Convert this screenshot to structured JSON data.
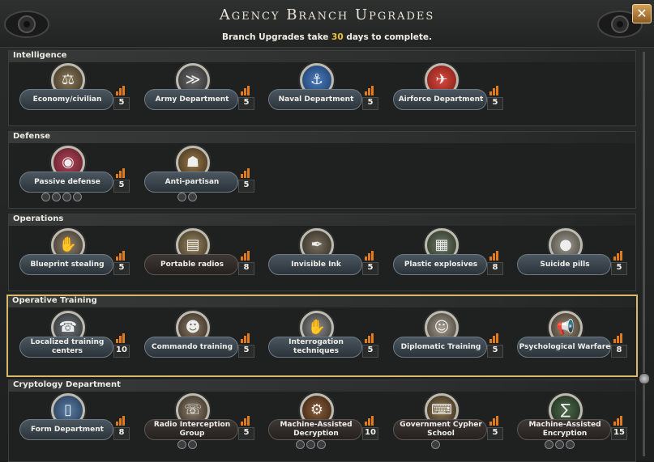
{
  "header": {
    "title": "Agency Branch Upgrades",
    "subtitle_prefix": "Branch Upgrades take ",
    "subtitle_days": "30",
    "subtitle_suffix": " days to complete.",
    "close_label": "✕"
  },
  "sections": [
    {
      "label": "Intelligence",
      "cards": [
        {
          "label": "Economy/civilian",
          "level": "5",
          "icon": "economy-emblem-icon"
        },
        {
          "label": "Army Department",
          "level": "5",
          "icon": "army-emblem-icon"
        },
        {
          "label": "Naval Department",
          "level": "5",
          "icon": "anchor-emblem-icon"
        },
        {
          "label": "Airforce Department",
          "level": "5",
          "icon": "airplane-emblem-icon"
        }
      ]
    },
    {
      "label": "Defense",
      "cards": [
        {
          "label": "Passive defense",
          "level": "5",
          "icon": "eye-emblem-icon"
        },
        {
          "label": "Anti-partisan",
          "level": "5",
          "icon": "partisan-icon"
        }
      ]
    },
    {
      "label": "Operations",
      "cards": [
        {
          "label": "Blueprint stealing",
          "level": "5",
          "icon": "blueprint-icon"
        },
        {
          "label": "Portable radios",
          "level": "8",
          "icon": "radio-icon"
        },
        {
          "label": "Invisible Ink",
          "level": "5",
          "icon": "ink-pen-icon"
        },
        {
          "label": "Plastic explosives",
          "level": "8",
          "icon": "explosives-icon"
        },
        {
          "label": "Suicide pills",
          "level": "5",
          "icon": "pills-icon"
        }
      ]
    },
    {
      "label": "Operative Training",
      "cards": [
        {
          "label": "Localized training centers",
          "level": "10",
          "icon": "training-center-icon"
        },
        {
          "label": "Commando training",
          "level": "5",
          "icon": "commando-icon"
        },
        {
          "label": "Interrogation techniques",
          "level": "5",
          "icon": "interrogation-icon"
        },
        {
          "label": "Diplomatic Training",
          "level": "5",
          "icon": "diplomat-icon"
        },
        {
          "label": "Psychological Warfare",
          "level": "8",
          "icon": "megaphone-icon"
        }
      ]
    },
    {
      "label": "Cryptology Department",
      "cards": [
        {
          "label": "Form Department",
          "level": "8",
          "icon": "document-emblem-icon"
        },
        {
          "label": "Radio Interception Group",
          "level": "5",
          "icon": "radio-interception-icon"
        },
        {
          "label": "Machine-Assisted Decryption",
          "level": "10",
          "icon": "decryption-gear-icon"
        },
        {
          "label": "Government Cypher School",
          "level": "5",
          "icon": "cypher-machine-icon"
        },
        {
          "label": "Machine-Assisted Encryption",
          "level": "15",
          "icon": "encryption-formula-icon"
        }
      ]
    }
  ]
}
